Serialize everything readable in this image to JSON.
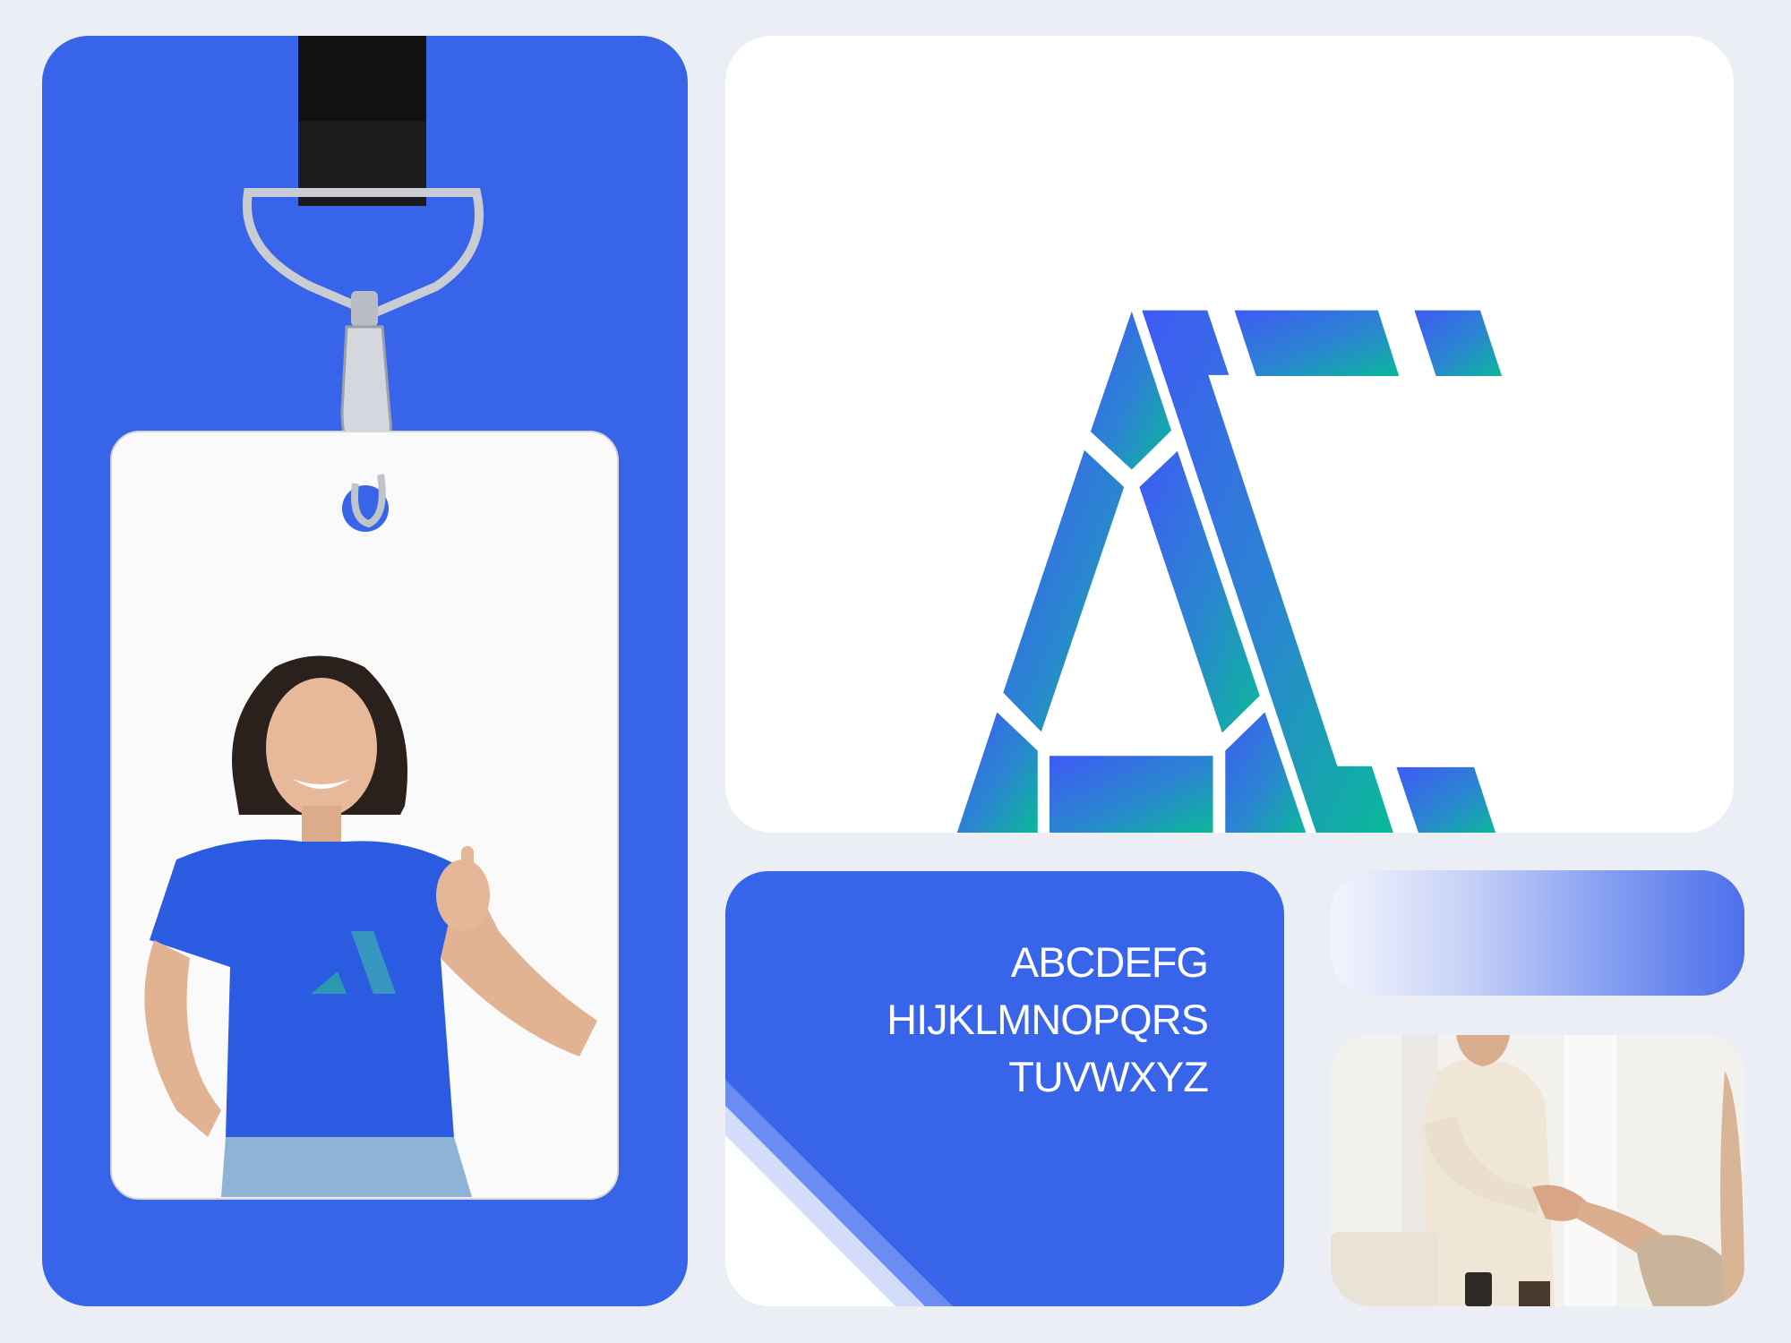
{
  "typography": {
    "lines": [
      "ABCDEFG",
      "HIJKLMNOPQRS",
      "TUVWXYZ"
    ]
  },
  "colors": {
    "background": "#ebeef5",
    "brand_blue": "#3864ea",
    "logo_gradient_start": "#3f5af5",
    "logo_gradient_end": "#0ab89a"
  }
}
